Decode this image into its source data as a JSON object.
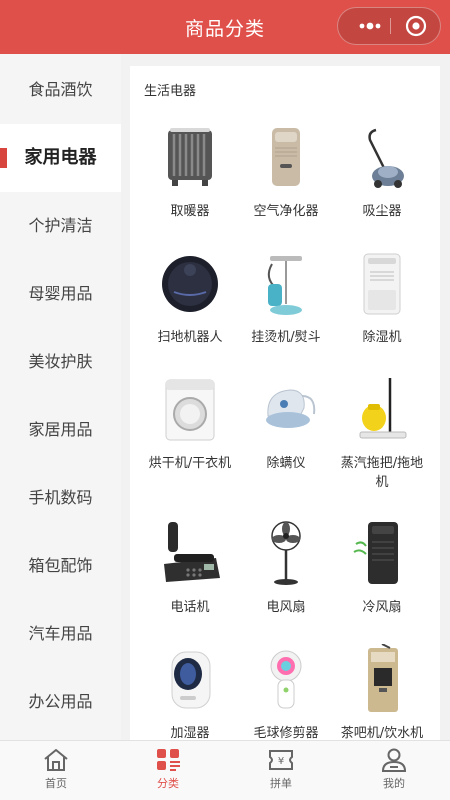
{
  "header": {
    "title": "商品分类"
  },
  "sidebar": {
    "items": [
      {
        "label": "食品酒饮"
      },
      {
        "label": "家用电器"
      },
      {
        "label": "个护清洁"
      },
      {
        "label": "母婴用品"
      },
      {
        "label": "美妆护肤"
      },
      {
        "label": "家居用品"
      },
      {
        "label": "手机数码"
      },
      {
        "label": "箱包配饰"
      },
      {
        "label": "汽车用品"
      },
      {
        "label": "办公用品"
      }
    ],
    "active_index": 1
  },
  "content": {
    "section_title": "生活电器",
    "products": [
      {
        "name": "取暖器",
        "icon": "heater-icon"
      },
      {
        "name": "空气净化器",
        "icon": "air-purifier-icon"
      },
      {
        "name": "吸尘器",
        "icon": "vacuum-cleaner-icon"
      },
      {
        "name": "扫地机器人",
        "icon": "robot-vacuum-icon"
      },
      {
        "name": "挂烫机/熨斗",
        "icon": "garment-steamer-icon"
      },
      {
        "name": "除湿机",
        "icon": "dehumidifier-icon"
      },
      {
        "name": "烘干机/干衣机",
        "icon": "dryer-icon"
      },
      {
        "name": "除螨仪",
        "icon": "mite-remover-icon"
      },
      {
        "name": "蒸汽拖把/拖地机",
        "icon": "steam-mop-icon"
      },
      {
        "name": "电话机",
        "icon": "telephone-icon"
      },
      {
        "name": "电风扇",
        "icon": "electric-fan-icon"
      },
      {
        "name": "冷风扇",
        "icon": "air-cooler-icon"
      },
      {
        "name": "加湿器",
        "icon": "humidifier-icon"
      },
      {
        "name": "毛球修剪器",
        "icon": "lint-remover-icon"
      },
      {
        "name": "茶吧机/饮水机",
        "icon": "water-dispenser-icon"
      }
    ]
  },
  "tabbar": {
    "tabs": [
      {
        "label": "首页",
        "icon": "home-icon"
      },
      {
        "label": "分类",
        "icon": "category-icon"
      },
      {
        "label": "拼单",
        "icon": "group-buy-icon"
      },
      {
        "label": "我的",
        "icon": "profile-icon"
      }
    ],
    "active_index": 1
  },
  "colors": {
    "accent": "#e0504a",
    "sidebar_bg": "#f5f5f5",
    "content_bg": "#ffffff"
  }
}
